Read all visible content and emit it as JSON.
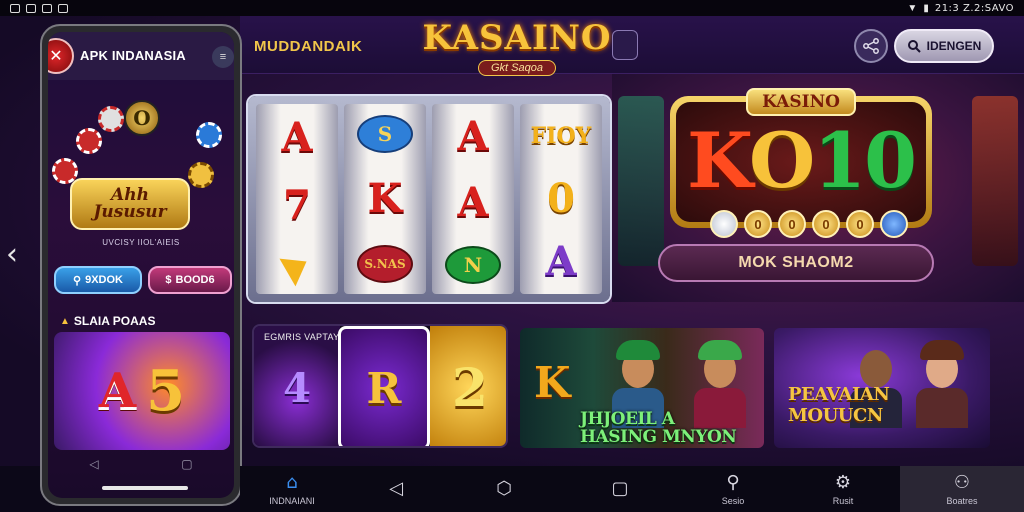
{
  "status_bar": {
    "left_icons": [
      "mail-icon",
      "notification-icon",
      "image-icon",
      "notification-icon"
    ],
    "time": "21:3 Z.2:SAVO"
  },
  "phone": {
    "title": "APK INDANASIA",
    "tagline": "UVCISY IIOL'AIEIS",
    "brand": "Ahh\nJususur",
    "coin_label": "O",
    "button_primary": "9XDOK",
    "button_secondary": "BOOD6",
    "section_title": "SLAIA POAAS",
    "game_left": "A",
    "game_right": "5"
  },
  "header": {
    "section_title": "MUDDANDAIK",
    "logo_main": "KASAINO",
    "logo_sub": "Gkt Saqoa",
    "search_label": "IDENGEN"
  },
  "slot": {
    "reels": [
      [
        {
          "text": "A",
          "style": "r"
        },
        {
          "text": "7",
          "style": "r"
        },
        {
          "text": "",
          "style": "tri"
        }
      ],
      [
        {
          "text": "S",
          "style": "b-blue"
        },
        {
          "text": "K",
          "style": "r"
        },
        {
          "text": "S.NAS",
          "style": "b-red"
        }
      ],
      [
        {
          "text": "A",
          "style": "r"
        },
        {
          "text": "A",
          "style": "r"
        },
        {
          "text": "N",
          "style": "b-green"
        }
      ],
      [
        {
          "text": "FIOY",
          "style": "g"
        },
        {
          "text": "0",
          "style": "g"
        },
        {
          "text": "A",
          "style": "p"
        }
      ]
    ]
  },
  "casino_panel": {
    "label": "KASINO",
    "big_text": [
      "K",
      "O",
      "1",
      "0"
    ],
    "coins": [
      "",
      "0",
      "0",
      "0",
      "0",
      ""
    ],
    "cta": "MOK SHAOM2"
  },
  "thumbs": {
    "row_title": "EGMRIS VAPTAY",
    "tile_1": "4",
    "tile_2": "R",
    "tile_3": "2",
    "middle_letter": "K",
    "middle_caption": "JHJOEIL A\nHASING MNYON",
    "right_caption": "PEAVAIAN\nMOUUCN"
  },
  "bottom_nav": [
    {
      "label": "INDNAIANI",
      "icon": "home-icon"
    },
    {
      "label": "",
      "icon": "back-icon"
    },
    {
      "label": "",
      "icon": "home-circle-icon"
    },
    {
      "label": "",
      "icon": "recents-icon"
    },
    {
      "label": "Sesio",
      "icon": "search-icon"
    },
    {
      "label": "Rusit",
      "icon": "gear-icon"
    },
    {
      "label": "Boatres",
      "icon": "user-icon"
    }
  ],
  "colors": {
    "accent_gold": "#f1c64a",
    "background": "#150a26",
    "nav_active": "#2a2634",
    "home_icon": "#3a8ef0"
  }
}
